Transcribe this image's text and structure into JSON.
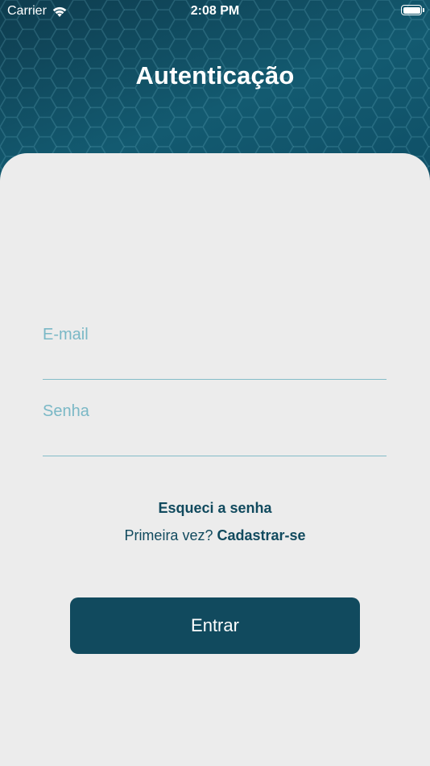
{
  "status_bar": {
    "carrier": "Carrier",
    "time": "2:08 PM",
    "wifi_icon": "wifi-icon",
    "battery_icon": "battery-icon"
  },
  "header": {
    "title": "Autenticação"
  },
  "form": {
    "email": {
      "placeholder": "E-mail",
      "value": ""
    },
    "password": {
      "placeholder": "Senha",
      "value": ""
    }
  },
  "links": {
    "forgot_password": "Esqueci a senha",
    "first_time_prefix": "Primeira vez?",
    "signup": "Cadastrar-se"
  },
  "actions": {
    "login_label": "Entrar"
  },
  "colors": {
    "primary": "#114a5e",
    "accent_light": "#7ab8c6",
    "card_background": "#ececec",
    "header_background": "#0f4a5e"
  }
}
